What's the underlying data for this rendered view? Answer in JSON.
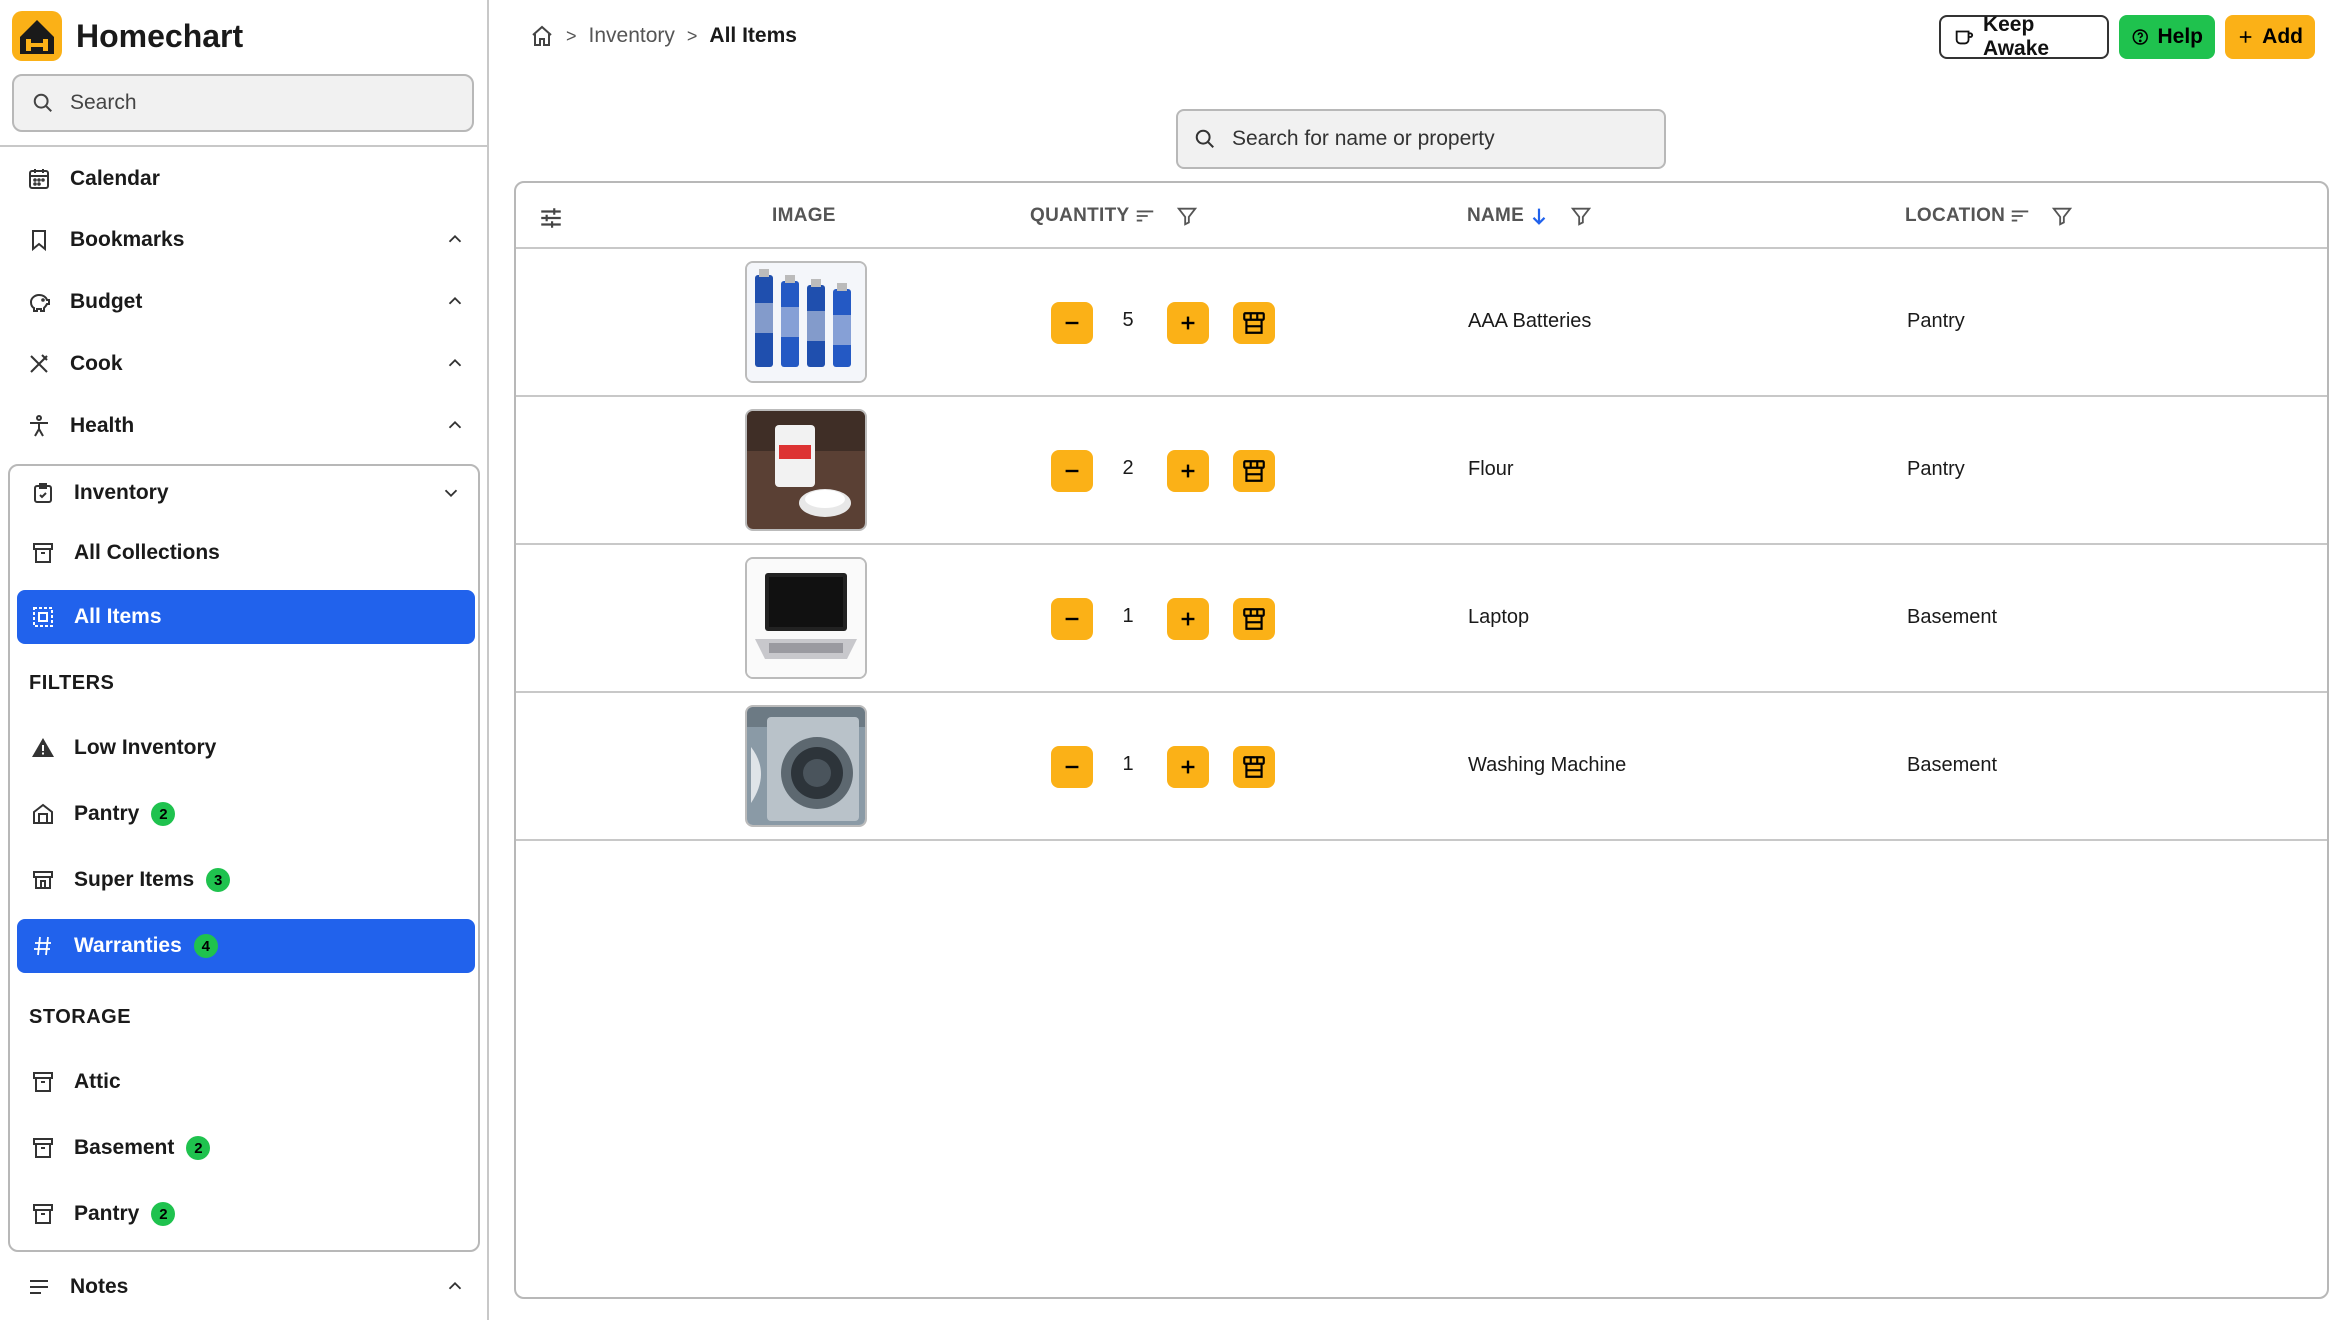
{
  "app": {
    "name": "Homechart"
  },
  "sidebar": {
    "search_placeholder": "Search",
    "top_items": [
      {
        "label": "Calendar",
        "icon": "calendar-icon"
      },
      {
        "label": "Bookmarks",
        "icon": "bookmark-icon"
      },
      {
        "label": "Budget",
        "icon": "piggy-bank-icon"
      },
      {
        "label": "Cook",
        "icon": "utensils-icon"
      },
      {
        "label": "Health",
        "icon": "person-icon"
      }
    ],
    "inventory": {
      "label": "Inventory",
      "all_collections": "All Collections",
      "all_items": "All Items",
      "filters_label": "FILTERS",
      "filters": [
        {
          "label": "Low Inventory",
          "count": ""
        },
        {
          "label": "Pantry",
          "count": "2"
        },
        {
          "label": "Super Items",
          "count": "3"
        },
        {
          "label": "Warranties",
          "count": "4"
        }
      ],
      "storage_label": "STORAGE",
      "storage": [
        {
          "label": "Attic",
          "count": ""
        },
        {
          "label": "Basement",
          "count": "2"
        },
        {
          "label": "Pantry",
          "count": "2"
        }
      ]
    },
    "notes": {
      "label": "Notes"
    }
  },
  "breadcrumb": {
    "parent": "Inventory",
    "current": "All Items"
  },
  "toolbar": {
    "keep_awake": "Keep Awake",
    "help": "Help",
    "add": "Add"
  },
  "main_search": {
    "placeholder": "Search for name or property"
  },
  "table": {
    "columns": {
      "image": "IMAGE",
      "quantity": "QUANTITY",
      "name": "NAME",
      "location": "LOCATION"
    },
    "rows": [
      {
        "quantity": "5",
        "name": "AAA Batteries",
        "location": "Pantry"
      },
      {
        "quantity": "2",
        "name": "Flour",
        "location": "Pantry"
      },
      {
        "quantity": "1",
        "name": "Laptop",
        "location": "Basement"
      },
      {
        "quantity": "1",
        "name": "Washing Machine",
        "location": "Basement"
      }
    ]
  },
  "colors": {
    "accent": "#2162ec",
    "warning": "#fbb117",
    "success": "#1fc24e"
  }
}
